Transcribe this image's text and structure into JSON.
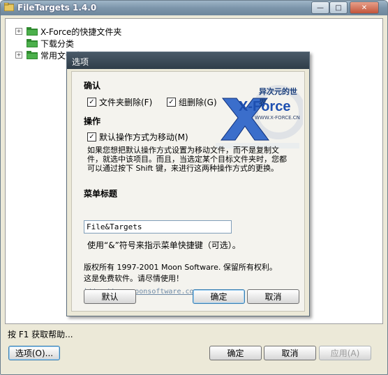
{
  "window": {
    "title": "FileTargets 1.4.0",
    "minimize_glyph": "—",
    "maximize_glyph": "□",
    "close_glyph": "✕"
  },
  "tree": {
    "items": [
      {
        "label": "X-Force的快捷文件夹",
        "expandable": true,
        "expander": "+"
      },
      {
        "label": "下载分类",
        "expandable": false,
        "expander": ""
      },
      {
        "label": "常用文件夹",
        "expandable": true,
        "expander": "+"
      }
    ]
  },
  "status": {
    "text": "按 F1 获取帮助..."
  },
  "footer": {
    "options_label": "选项(O)...",
    "ok_label": "确定",
    "cancel_label": "取消",
    "apply_label": "应用(A)"
  },
  "dialog": {
    "title": "选项",
    "confirm_header": "确认",
    "folder_delete_label": "文件夹删除(F)",
    "group_delete_label": "组删除(G)",
    "operation_header": "操作",
    "default_move_label": "默认操作方式为移动(M)",
    "move_note_lines": [
      "如果您想把默认操作方式设置为移动文件，而不是复制文",
      "件，就选中该项目。而且，当选定某个目标文件夹时，您都",
      "可以通过按下 Shift 键，来进行这两种操作方式的更换。"
    ],
    "menu_title_header": "菜单标题",
    "menu_title_value": "File&Targets",
    "menu_hint": "使用“&”符号来指示菜单快捷键（可选）。",
    "copyright_line1": "版权所有 1997-2001 Moon Software. 保留所有权利。",
    "copyright_line2": "这是免费软件。请尽情使用！",
    "website": "http://www.moonsoftware.com",
    "default_button": "默认",
    "ok_button": "确定",
    "cancel_button": "取消",
    "folder_delete_checked": true,
    "group_delete_checked": true,
    "default_move_checked": true
  },
  "logo": {
    "text_main": "X-Force",
    "text_cn": "异次元的世界",
    "text_url": "WWW.X-FORCE.CN"
  },
  "colors": {
    "accent_blue": "#3c7fb1",
    "folder_green": "#2f8a2f",
    "logo_blue": "#2a63c8"
  }
}
